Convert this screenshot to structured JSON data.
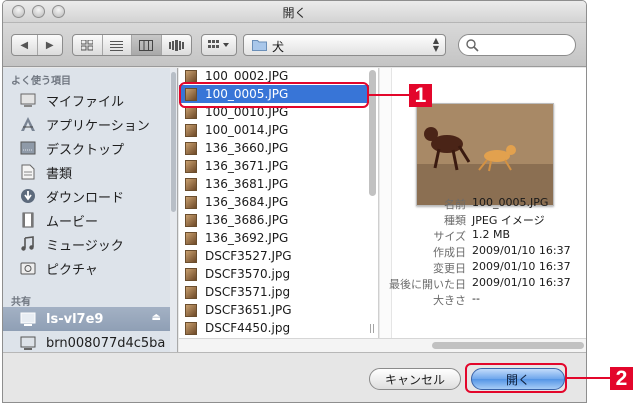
{
  "window": {
    "title": "開く"
  },
  "toolbar": {
    "nav_back": "◀",
    "nav_forward": "▶",
    "location": "犬",
    "search_placeholder": ""
  },
  "sidebar": {
    "favorites_heading": "よく使う項目",
    "favorites": [
      {
        "label": "マイファイル",
        "icon": "my-files-icon"
      },
      {
        "label": "アプリケーション",
        "icon": "applications-icon"
      },
      {
        "label": "デスクトップ",
        "icon": "desktop-icon"
      },
      {
        "label": "書類",
        "icon": "documents-icon"
      },
      {
        "label": "ダウンロード",
        "icon": "downloads-icon"
      },
      {
        "label": "ムービー",
        "icon": "movies-icon"
      },
      {
        "label": "ミュージック",
        "icon": "music-icon"
      },
      {
        "label": "ピクチャ",
        "icon": "pictures-icon"
      }
    ],
    "shared_heading": "共有",
    "shared": [
      {
        "label": "ls-vl7e9",
        "icon": "network-drive-icon",
        "selected": true
      },
      {
        "label": "brn008077d4c5ba",
        "icon": "network-computer-icon",
        "selected": false
      }
    ]
  },
  "files": [
    {
      "name": "100_0002.JPG"
    },
    {
      "name": "100_0005.JPG",
      "selected": true
    },
    {
      "name": "100_0010.JPG"
    },
    {
      "name": "100_0014.JPG"
    },
    {
      "name": "136_3660.JPG"
    },
    {
      "name": "136_3671.JPG"
    },
    {
      "name": "136_3681.JPG"
    },
    {
      "name": "136_3684.JPG"
    },
    {
      "name": "136_3686.JPG"
    },
    {
      "name": "136_3692.JPG"
    },
    {
      "name": "DSCF3527.JPG"
    },
    {
      "name": "DSCF3570.jpg"
    },
    {
      "name": "DSCF3571.jpg"
    },
    {
      "name": "DSCF3651.JPG"
    },
    {
      "name": "DSCF4450.jpg"
    }
  ],
  "preview": {
    "info": [
      {
        "key": "名前",
        "value": "100_0005.JPG"
      },
      {
        "key": "種類",
        "value": "JPEG イメージ"
      },
      {
        "key": "サイズ",
        "value": "1.2 MB"
      },
      {
        "key": "作成日",
        "value": "2009/01/10 16:37"
      },
      {
        "key": "変更日",
        "value": "2009/01/10 16:37"
      },
      {
        "key": "最後に開いた日",
        "value": "2009/01/10 16:37"
      },
      {
        "key": "大きさ",
        "value": "--"
      }
    ]
  },
  "buttons": {
    "cancel": "キャンセル",
    "open": "開く"
  },
  "callouts": {
    "one": "1",
    "two": "2"
  },
  "colors": {
    "accent": "#e3062b",
    "selection": "#3875d7",
    "open_button": "#6ea6ec"
  }
}
